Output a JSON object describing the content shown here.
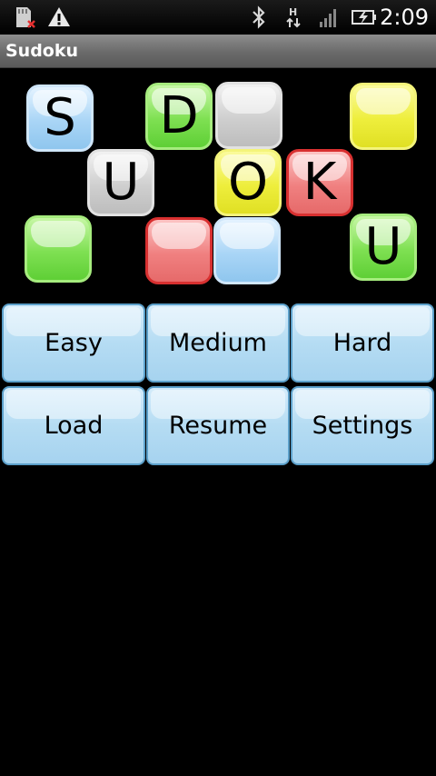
{
  "status_bar": {
    "time": "2:09",
    "icons": [
      "sd-card-removed-icon",
      "warning-icon",
      "bluetooth-icon",
      "hspa-data-icon",
      "signal-strength-icon",
      "battery-charging-icon"
    ]
  },
  "title_bar": {
    "title": "Sudoku"
  },
  "logo": {
    "tiles": [
      {
        "letter": "S",
        "color": "blue"
      },
      {
        "letter": "D",
        "color": "green"
      },
      {
        "letter": "",
        "color": "gray"
      },
      {
        "letter": "",
        "color": "yellow"
      },
      {
        "letter": "U",
        "color": "gray"
      },
      {
        "letter": "O",
        "color": "yellow"
      },
      {
        "letter": "K",
        "color": "red"
      },
      {
        "letter": "",
        "color": "green"
      },
      {
        "letter": "",
        "color": "red"
      },
      {
        "letter": "",
        "color": "blue"
      },
      {
        "letter": "U",
        "color": "green"
      }
    ]
  },
  "menu": {
    "easy": "Easy",
    "medium": "Medium",
    "hard": "Hard",
    "load": "Load",
    "resume": "Resume",
    "settings": "Settings"
  },
  "colors": {
    "button_fill": "#b5dcf3",
    "button_border": "#5b9fc9",
    "background": "#000000",
    "title_bar": "#6a6a6a"
  }
}
